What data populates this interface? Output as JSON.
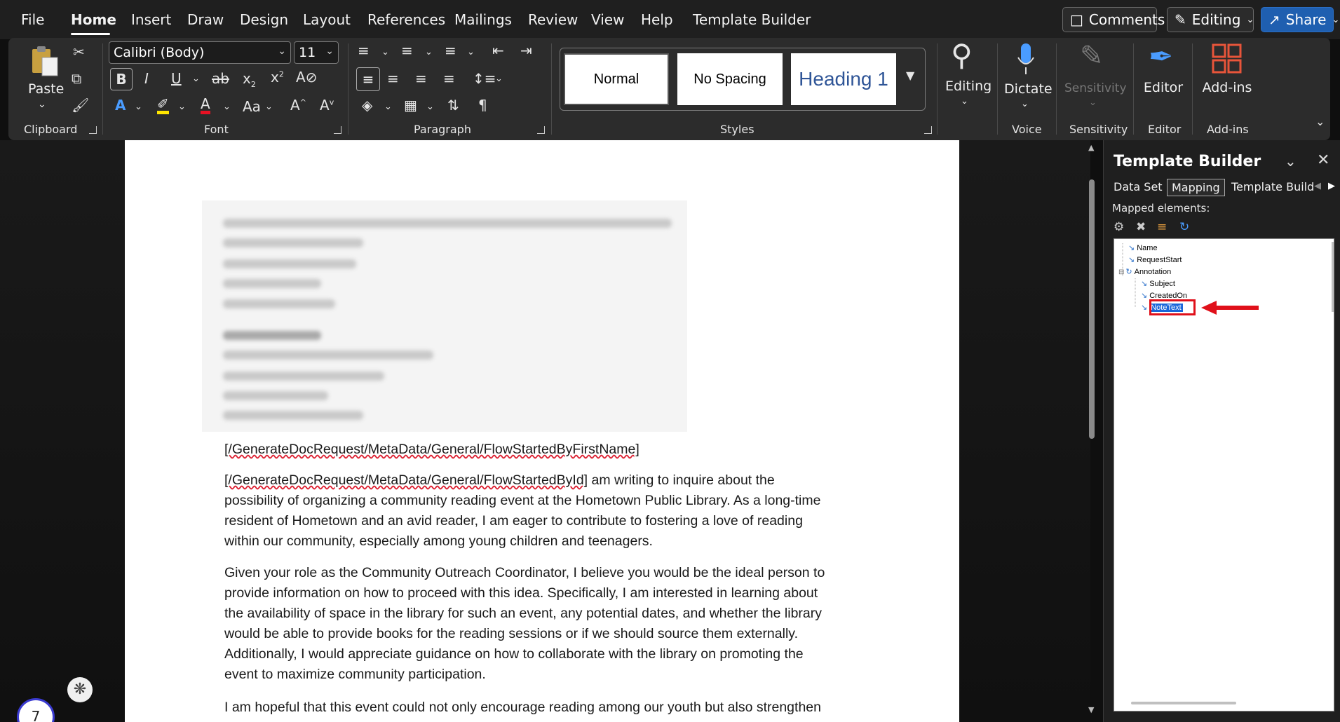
{
  "menu": {
    "items": [
      "File",
      "Home",
      "Insert",
      "Draw",
      "Design",
      "Layout",
      "References",
      "Mailings",
      "Review",
      "View",
      "Help",
      "Template Builder"
    ],
    "active": "Home"
  },
  "top_buttons": {
    "comments": "Comments",
    "editing": "Editing",
    "share": "Share"
  },
  "ribbon": {
    "clipboard": {
      "label": "Clipboard",
      "paste": "Paste"
    },
    "font": {
      "label": "Font",
      "family": "Calibri (Body)",
      "size": "11",
      "change_case": "Aa"
    },
    "paragraph": {
      "label": "Paragraph"
    },
    "styles": {
      "label": "Styles",
      "items": [
        "Normal",
        "No Spacing",
        "Heading 1"
      ]
    },
    "editing": {
      "label": "Editing"
    },
    "voice": {
      "label": "Voice",
      "dictate": "Dictate"
    },
    "sensitivity": {
      "label": "Sensitivity",
      "button": "Sensitivity"
    },
    "editor": {
      "label": "Editor",
      "button": "Editor"
    },
    "addins": {
      "label": "Add-ins",
      "button": "Add-ins"
    }
  },
  "document": {
    "line1": "[/GenerateDocRequest/MetaData/General/FlowStartedByFirstName]",
    "p1_field": "[/GenerateDocRequest/MetaData/General/FlowStartedById]",
    "p1_lines": [
      " am writing to inquire about the",
      "possibility of organizing a community reading event at the Hometown Public Library. As a long-time",
      "resident of Hometown and an avid reader, I am eager to contribute to fostering a love of reading",
      "within our community, especially among young children and teenagers."
    ],
    "p2_lines": [
      "Given your role as the Community Outreach Coordinator, I believe you would be the ideal person to",
      "provide information on how to proceed with this idea. Specifically, I am interested in learning about",
      "the availability of space in the library for such an event, any potential dates, and whether the library",
      "would be able to provide books for the reading sessions or if we should source them externally.",
      "Additionally, I would appreciate guidance on how to collaborate with the library on promoting the",
      "event to maximize community participation."
    ],
    "p3_line": "I am hopeful that this event could not only encourage reading among our youth but also strengthen"
  },
  "pane": {
    "title": "Template Builder",
    "tabs": [
      "Data Set",
      "Mapping",
      "Template Build"
    ],
    "selected_tab": "Mapping",
    "mapped_label": "Mapped elements:",
    "tree": [
      {
        "label": "Name"
      },
      {
        "label": "RequestStart"
      },
      {
        "label": "Annotation"
      },
      {
        "label": "Subject"
      },
      {
        "label": "CreatedOn"
      },
      {
        "label": "NoteText"
      }
    ]
  },
  "badge": {
    "count": "7"
  },
  "colors": {
    "accent": "#1f5fb0",
    "highlight": "#e0101a"
  }
}
